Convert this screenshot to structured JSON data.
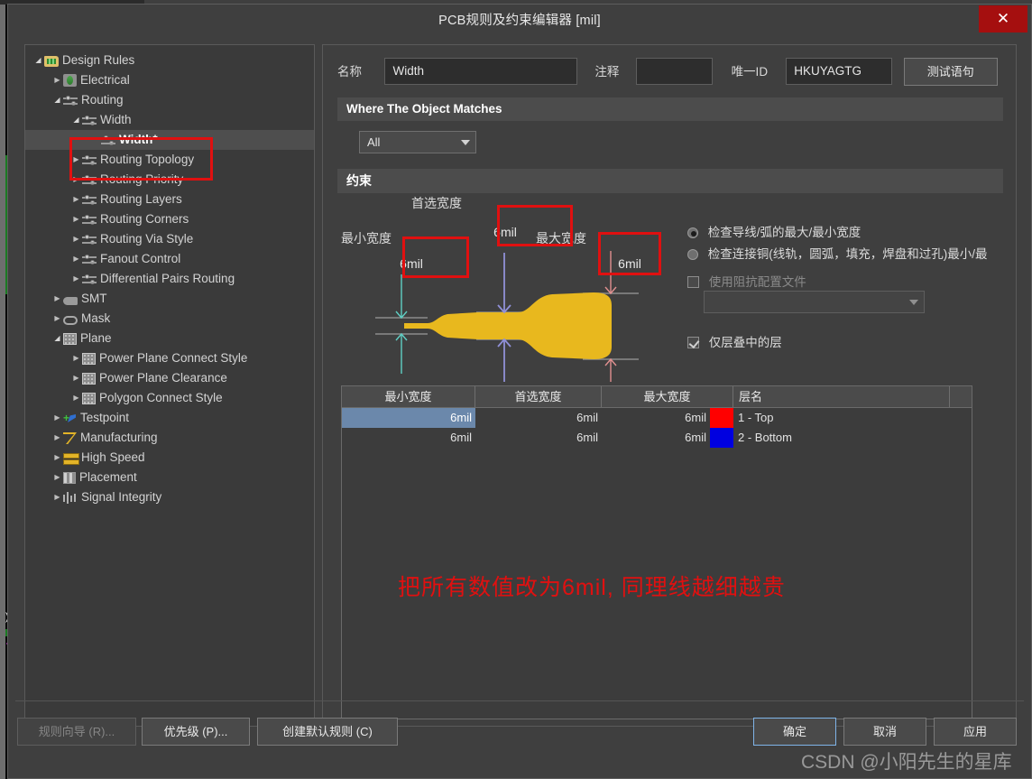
{
  "window": {
    "title": "PCB规则及约束编辑器 [mil]",
    "close_label": "✕"
  },
  "sidebar": {
    "items": [
      {
        "label": "Design Rules",
        "icon": "folder-icon",
        "depth": 0,
        "arrow": "down",
        "selected": false
      },
      {
        "label": "Electrical",
        "icon": "electrical-icon",
        "depth": 1,
        "arrow": "right",
        "selected": false
      },
      {
        "label": "Routing",
        "icon": "routing-icon",
        "depth": 1,
        "arrow": "down",
        "selected": false
      },
      {
        "label": "Width",
        "icon": "routing-icon",
        "depth": 2,
        "arrow": "down",
        "selected": false
      },
      {
        "label": "Width*",
        "icon": "routing-icon",
        "depth": 3,
        "arrow": "none",
        "selected": true
      },
      {
        "label": "Routing Topology",
        "icon": "routing-icon",
        "depth": 2,
        "arrow": "right",
        "selected": false
      },
      {
        "label": "Routing Priority",
        "icon": "routing-icon",
        "depth": 2,
        "arrow": "right",
        "selected": false
      },
      {
        "label": "Routing Layers",
        "icon": "routing-icon",
        "depth": 2,
        "arrow": "right",
        "selected": false
      },
      {
        "label": "Routing Corners",
        "icon": "routing-icon",
        "depth": 2,
        "arrow": "right",
        "selected": false
      },
      {
        "label": "Routing Via Style",
        "icon": "routing-icon",
        "depth": 2,
        "arrow": "right",
        "selected": false
      },
      {
        "label": "Fanout Control",
        "icon": "routing-icon",
        "depth": 2,
        "arrow": "right",
        "selected": false
      },
      {
        "label": "Differential Pairs Routing",
        "icon": "routing-icon",
        "depth": 2,
        "arrow": "right",
        "selected": false
      },
      {
        "label": "SMT",
        "icon": "smt-icon",
        "depth": 1,
        "arrow": "right",
        "selected": false
      },
      {
        "label": "Mask",
        "icon": "mask-icon",
        "depth": 1,
        "arrow": "right",
        "selected": false
      },
      {
        "label": "Plane",
        "icon": "plane-icon",
        "depth": 1,
        "arrow": "down",
        "selected": false
      },
      {
        "label": "Power Plane Connect Style",
        "icon": "plane-icon",
        "depth": 2,
        "arrow": "right",
        "selected": false
      },
      {
        "label": "Power Plane Clearance",
        "icon": "plane-icon",
        "depth": 2,
        "arrow": "right",
        "selected": false
      },
      {
        "label": "Polygon Connect Style",
        "icon": "plane-icon",
        "depth": 2,
        "arrow": "right",
        "selected": false
      },
      {
        "label": "Testpoint",
        "icon": "testpoint-icon",
        "depth": 1,
        "arrow": "right",
        "selected": false
      },
      {
        "label": "Manufacturing",
        "icon": "manufacturing-icon",
        "depth": 1,
        "arrow": "right",
        "selected": false
      },
      {
        "label": "High Speed",
        "icon": "highspeed-icon",
        "depth": 1,
        "arrow": "right",
        "selected": false
      },
      {
        "label": "Placement",
        "icon": "placement-icon",
        "depth": 1,
        "arrow": "right",
        "selected": false
      },
      {
        "label": "Signal Integrity",
        "icon": "signalintegrity-icon",
        "depth": 1,
        "arrow": "right",
        "selected": false
      }
    ]
  },
  "form": {
    "name_label": "名称",
    "name_value": "Width",
    "comment_label": "注释",
    "comment_value": "",
    "uniqueid_label": "唯一ID",
    "uniqueid_value": "HKUYAGTG",
    "test_button": "测试语句"
  },
  "match_section": {
    "header": "Where The Object Matches",
    "scope_value": "All"
  },
  "constraint_section": {
    "header": "约束",
    "preferred_width_label": "首选宽度",
    "preferred_width_value": "6mil",
    "min_width_label": "最小宽度",
    "min_width_value": "6mil",
    "max_width_label": "最大宽度",
    "max_width_value": "6mil",
    "radio_track_label": "检查导线/弧的最大/最小宽度",
    "radio_copper_label": "检查连接铜(线轨，圆弧，填充，焊盘和过孔)最小/最",
    "impedance_checkbox_label": "使用阻抗配置文件",
    "impedance_value": "",
    "layers_checkbox_label": "仅层叠中的层"
  },
  "table": {
    "columns": [
      "最小宽度",
      "首选宽度",
      "最大宽度",
      "层名"
    ],
    "rows": [
      {
        "min": "6mil",
        "preferred": "6mil",
        "max": "6mil",
        "color": "#ff0000",
        "layer": "1 - Top",
        "selected": true
      },
      {
        "min": "6mil",
        "preferred": "6mil",
        "max": "6mil",
        "color": "#0000e0",
        "layer": "2 - Bottom",
        "selected": false
      }
    ]
  },
  "annotation": {
    "text": "把所有数值改为6mil, 同理线越细越贵",
    "color": "#e01010"
  },
  "footer": {
    "rule_wizard": "规则向导 (R)...",
    "priority": "优先级 (P)...",
    "create_default": "创建默认规则 (C)",
    "ok": "确定",
    "cancel": "取消",
    "apply": "应用"
  },
  "watermark": {
    "text": "CSDN @小阳先生的星库"
  }
}
